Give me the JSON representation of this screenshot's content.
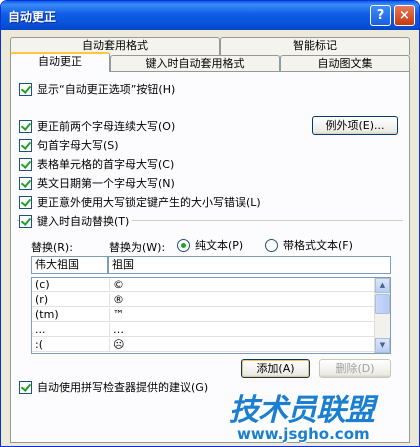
{
  "window": {
    "title": "自动更正",
    "help_glyph": "?",
    "close_glyph": "×"
  },
  "tabs": {
    "row1": [
      "自动套用格式",
      "智能标记"
    ],
    "row2": [
      "自动更正",
      "键入时自动套用格式",
      "自动图文集"
    ]
  },
  "options": {
    "show_buttons": "显示“自动更正选项”按钮(H)",
    "two_initial_caps": "更正前两个字母连续大写(O)",
    "capitalize_sentence": "句首字母大写(S)",
    "capitalize_table_cell": "表格单元格的首字母大写(C)",
    "capitalize_days": "英文日期第一个字母大写(N)",
    "caps_lock": "更正意外使用大写锁定键产生的大小写错误(L)",
    "replace_as_you_type": "键入时自动替换(T)"
  },
  "buttons": {
    "exceptions": "例外项(E)...",
    "add": "添加(A)",
    "delete": "删除(D)"
  },
  "replace": {
    "replace_label": "替换(R):",
    "with_label": "替换为(W):",
    "plain_text": "纯文本(P)",
    "formatted_text": "带格式文本(F)",
    "replace_value": "伟大祖国",
    "with_value": "祖国"
  },
  "list": {
    "rows": [
      {
        "from": "(c)",
        "to": "©"
      },
      {
        "from": "(r)",
        "to": "®"
      },
      {
        "from": "(tm)",
        "to": "™"
      },
      {
        "from": "...",
        "to": "…"
      },
      {
        "from": ":(",
        "to": "☹"
      }
    ]
  },
  "spellcheck": "自动使用拼写检查器提供的建议(G)",
  "watermark": {
    "brand": "技术员联盟",
    "url": "www.jsgho.com"
  }
}
